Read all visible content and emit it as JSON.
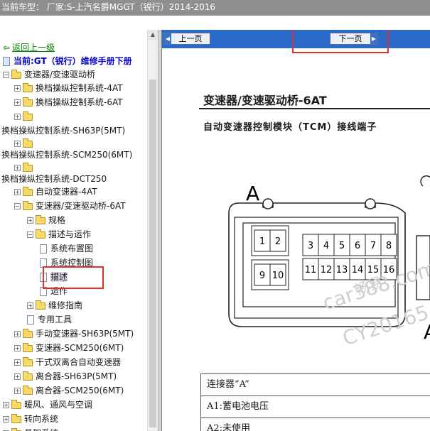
{
  "window": {
    "title": "当前车型： 厂家:S-上汽名爵MGGT（锐行）2014-2016"
  },
  "sidebar": {
    "back_link": "返回上一级",
    "manual_title": "当前:GT（锐行）维修手册下册",
    "tree": [
      {
        "label": "变速器/变速驱动桥",
        "toggle": "−",
        "kind": "folder"
      },
      {
        "label": "换档操纵控制系统-4AT",
        "toggle": "+",
        "kind": "folder"
      },
      {
        "label": "换档操纵控制系统-6AT",
        "toggle": "+",
        "kind": "folder"
      },
      {
        "label": "",
        "toggle": "+",
        "kind": "folder"
      },
      {
        "label": "换档操纵控制系统-SH63P(5MT)",
        "toggle": "",
        "kind": "text"
      },
      {
        "label": "",
        "toggle": "+",
        "kind": "folder"
      },
      {
        "label": "换档操纵控制系统-SCM250(6MT)",
        "toggle": "",
        "kind": "text"
      },
      {
        "label": "",
        "toggle": "+",
        "kind": "folder"
      },
      {
        "label": "换档操纵控制系统-DCT250",
        "toggle": "",
        "kind": "text"
      },
      {
        "label": "自动变速器-4AT",
        "toggle": "+",
        "kind": "folder"
      },
      {
        "label": "变速器/变速驱动桥-6AT",
        "toggle": "−",
        "kind": "folder"
      },
      {
        "label": "规格",
        "toggle": "+",
        "kind": "folder"
      },
      {
        "label": "描述与运作",
        "toggle": "−",
        "kind": "folder"
      },
      {
        "label": "系统布置图",
        "toggle": "",
        "kind": "doc"
      },
      {
        "label": "系统控制图",
        "toggle": "",
        "kind": "doc"
      },
      {
        "label": "描述",
        "toggle": "",
        "kind": "doc"
      },
      {
        "label": "运作",
        "toggle": "",
        "kind": "doc"
      },
      {
        "label": "维修指南",
        "toggle": "+",
        "kind": "folder"
      },
      {
        "label": "专用工具",
        "toggle": "",
        "kind": "doc"
      },
      {
        "label": "手动变速器-SH63P(5MT)",
        "toggle": "+",
        "kind": "folder"
      },
      {
        "label": "变速器-SCM250(6MT)",
        "toggle": "+",
        "kind": "folder"
      },
      {
        "label": "干式双离合自动变速器",
        "toggle": "+",
        "kind": "folder"
      },
      {
        "label": "离合器-SH63P(5MT)",
        "toggle": "+",
        "kind": "folder"
      },
      {
        "label": "离合器-SCM250(6MT)",
        "toggle": "+",
        "kind": "folder"
      },
      {
        "label": "暖风、通风与空调",
        "toggle": "+",
        "kind": "folder"
      },
      {
        "label": "转向系统",
        "toggle": "+",
        "kind": "folder"
      },
      {
        "label": "悬架系统",
        "toggle": "+",
        "kind": "folder"
      }
    ]
  },
  "content": {
    "prev_label": "上一页",
    "next_label": "下一页",
    "section_title": "变速器/变速驱动桥-6AT",
    "subtitle": "自动变速器控制模块（TCM）接线端子",
    "connector_label": "A",
    "connector_label_right": "A",
    "pins_top_left": [
      "1",
      "2"
    ],
    "pins_top_right": [
      "3",
      "4",
      "5",
      "6",
      "7",
      "8"
    ],
    "pins_bottom_left": [
      "9",
      "10"
    ],
    "pins_bottom_right": [
      "11",
      "12",
      "13",
      "14",
      "15",
      "16"
    ],
    "watermark_1": "畅易",
    "watermark_2": "car388.com",
    "watermark_3": "CY20165",
    "table_rows": [
      "连接器“A”",
      "A1:蓄电池电压",
      "A2:未使用"
    ]
  }
}
